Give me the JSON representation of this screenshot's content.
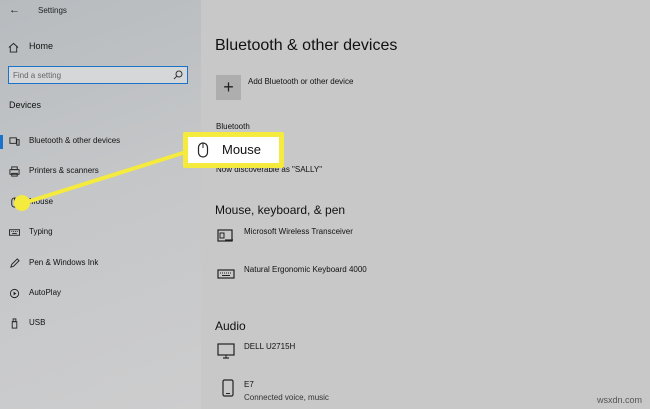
{
  "window": {
    "title": "Settings"
  },
  "sidebar": {
    "home_label": "Home",
    "search_placeholder": "Find a setting",
    "section": "Devices",
    "items": [
      {
        "label": "Bluetooth & other devices",
        "icon": "bluetooth-devices-icon"
      },
      {
        "label": "Printers & scanners",
        "icon": "printer-icon"
      },
      {
        "label": "Mouse",
        "icon": "mouse-icon"
      },
      {
        "label": "Typing",
        "icon": "keyboard-icon"
      },
      {
        "label": "Pen & Windows Ink",
        "icon": "pen-icon"
      },
      {
        "label": "AutoPlay",
        "icon": "autoplay-icon"
      },
      {
        "label": "USB",
        "icon": "usb-icon"
      }
    ]
  },
  "main": {
    "title": "Bluetooth & other devices",
    "add_label": "Add Bluetooth or other device",
    "bluetooth_heading": "Bluetooth",
    "discoverable_text": "Now discoverable as \"SALLY\"",
    "mouse_section": "Mouse, keyboard, & pen",
    "mouse_devices": [
      {
        "name": "Microsoft Wireless Transceiver",
        "icon": "transceiver-icon"
      },
      {
        "name": "Natural Ergonomic Keyboard 4000",
        "icon": "keyboard-icon"
      }
    ],
    "audio_section": "Audio",
    "audio_devices": [
      {
        "name": "DELL U2715H",
        "status": "",
        "icon": "monitor-icon"
      },
      {
        "name": "E7",
        "status": "Connected voice, music",
        "icon": "phone-icon"
      }
    ]
  },
  "callout": {
    "label": "Mouse",
    "color": "#f5ea3e"
  },
  "watermark": "wsxdn.com"
}
